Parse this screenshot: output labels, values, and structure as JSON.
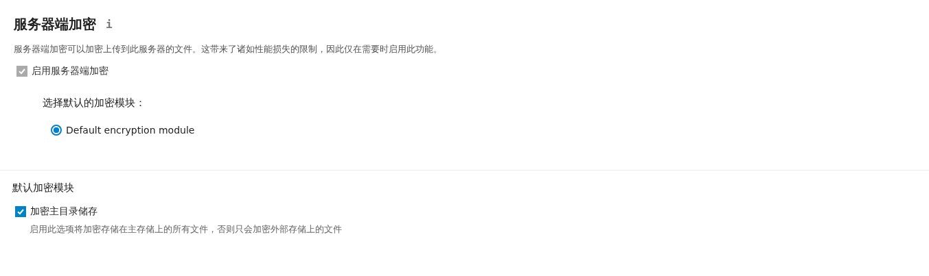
{
  "sections": [
    {
      "title": "服务器端加密",
      "info_icon": "i",
      "description": "服务器端加密可以加密上传到此服务器的文件。这带来了诸如性能损失的限制，因此仅在需要时启用此功能。",
      "enable_checkbox": {
        "label": "启用服务器端加密",
        "checked": true,
        "disabled": true
      },
      "module_prompt": "选择默认的加密模块：",
      "modules": [
        {
          "label": "Default encryption module",
          "selected": true
        }
      ]
    },
    {
      "title": "默认加密模块",
      "options": [
        {
          "label": "加密主目录储存",
          "checked": true,
          "disabled": false,
          "hint": "启用此选项将加密存储在主存储上的所有文件，否则只会加密外部存储上的文件"
        }
      ]
    }
  ]
}
